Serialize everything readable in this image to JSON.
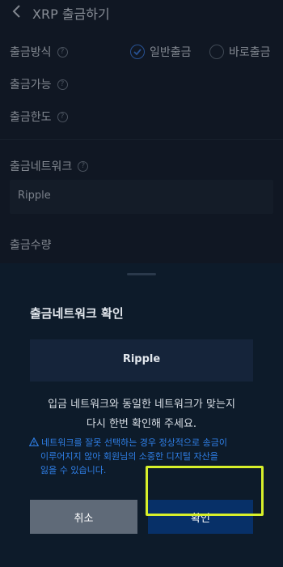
{
  "header": {
    "title": "XRP 출금하기"
  },
  "form": {
    "method_label": "출금방식",
    "option_normal": "일반출금",
    "option_direct": "바로출금",
    "available_label": "출금가능",
    "limit_label": "출금한도",
    "network_label": "출금네트워크",
    "network_value": "Ripple",
    "amount_label": "출금수량"
  },
  "dialog": {
    "title": "출금네트워크 확인",
    "network_value": "Ripple",
    "message_line1": "입금 네트워크와 동일한 네트워크가 맞는지",
    "message_line2": "다시 한번 확인해 주세요.",
    "warning_line1": "네트워크를 잘못 선택하는 경우 정상적으로 송금이",
    "warning_line2": "이루어지지 않아 회원님의 소중한 디지털 자산을",
    "warning_line3": "잃을 수 있습니다.",
    "cancel_label": "취소",
    "confirm_label": "확인"
  },
  "colors": {
    "background": "#16202d",
    "sheet": "#0d1b2a",
    "accent_blue": "#2f7fe6",
    "confirm_button": "#073068",
    "cancel_button": "#5f6a78",
    "highlight": "#d7f02a"
  },
  "icons": [
    "chevron-left-icon",
    "question-icon",
    "check-circle-icon",
    "radio-empty-icon",
    "warning-triangle-icon"
  ]
}
